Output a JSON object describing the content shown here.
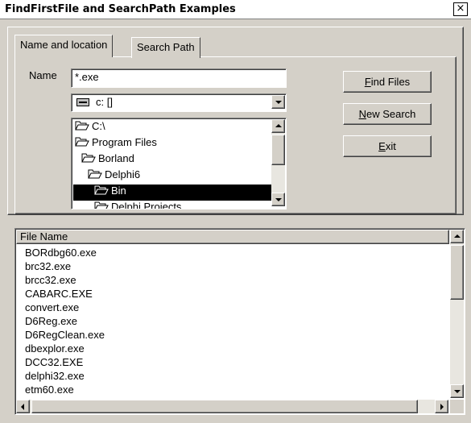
{
  "window": {
    "title": "FindFirstFile and SearchPath Examples",
    "close_glyph": "×"
  },
  "tabs": [
    {
      "label": "Name and location",
      "active": true
    },
    {
      "label": "Search Path",
      "active": false
    }
  ],
  "name_field": {
    "label": "Name",
    "value": "*.exe"
  },
  "drive_combo": {
    "value": "c: []"
  },
  "directories": [
    {
      "label": "C:\\",
      "selected": false
    },
    {
      "label": "Program Files",
      "selected": false
    },
    {
      "label": "Borland",
      "selected": false
    },
    {
      "label": "Delphi6",
      "selected": false
    },
    {
      "label": "Bin",
      "selected": true
    },
    {
      "label": "Delphi Projects",
      "selected": false
    }
  ],
  "buttons": {
    "find_prefix": "F",
    "find_rest": "ind Files",
    "new_prefix": "N",
    "new_rest": "ew Search",
    "exit_prefix": "E",
    "exit_rest": "xit"
  },
  "results": {
    "column_header": "File Name",
    "rows": [
      "BORdbg60.exe",
      "brc32.exe",
      "brcc32.exe",
      "CABARC.EXE",
      "convert.exe",
      "D6Reg.exe",
      "D6RegClean.exe",
      "dbexplor.exe",
      "DCC32.EXE",
      "delphi32.exe",
      "etm60.exe"
    ]
  },
  "colors": {
    "face": "#d4d0c8",
    "selection": "#000000",
    "window": "#ffffff"
  }
}
